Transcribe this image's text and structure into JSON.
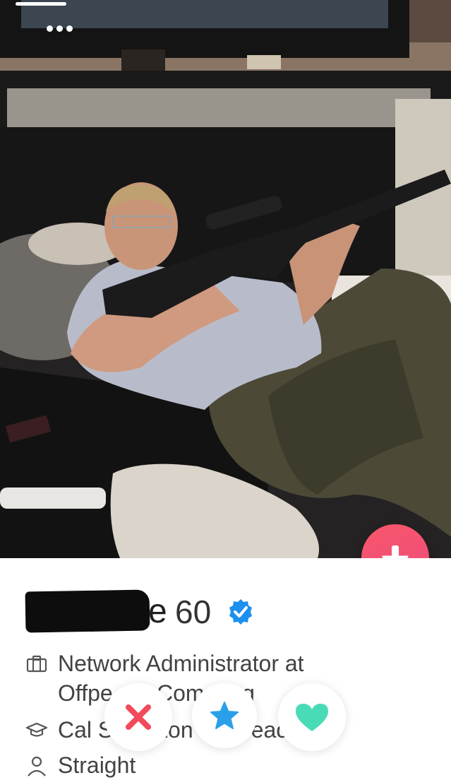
{
  "photo": {
    "description_icon": "profile-photo",
    "story_progress": 1
  },
  "top_controls": {
    "more_icon": "more-dots-icon"
  },
  "profile": {
    "name_visible_tail": "ce",
    "age": "60",
    "verified_icon": "verified-badge-icon",
    "job": "Network Administrator at Offpe",
    "job_line2_fragments": [
      "Comp",
      "ting"
    ],
    "school_fragments": [
      "Cal S",
      "Lon",
      "eac"
    ],
    "orientation": "Straight"
  },
  "actions": {
    "expand_icon": "arrow-down-icon",
    "nope_icon": "x-icon",
    "superlike_icon": "star-icon",
    "like_icon": "heart-icon"
  },
  "colors": {
    "accent_red": "#ef4f73",
    "nope": "#f24a5b",
    "superlike": "#2ba0ea",
    "like": "#49dbb6",
    "verified": "#1d8fef"
  }
}
